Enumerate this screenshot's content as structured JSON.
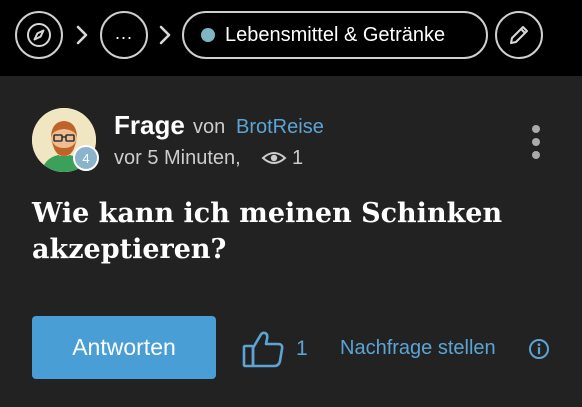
{
  "breadcrumb": {
    "more_label": "...",
    "category_label": "Lebensmittel & Getränke",
    "category_color": "#7fb6c4"
  },
  "post": {
    "type_label": "Frage",
    "by_label": "von",
    "author": "BrotReise",
    "author_level": "4",
    "time": "vor 5 Minuten,",
    "views": "1",
    "question": "Wie kann ich meinen Schinken akzeptieren?"
  },
  "actions": {
    "answer_label": "Antworten",
    "like_count": "1",
    "followup_label": "Nachfrage stellen"
  },
  "colors": {
    "accent": "#4a9ed6",
    "link": "#5ba4d4",
    "background": "#222222",
    "topbar": "#000000"
  },
  "icons": [
    "compass-icon",
    "chevron-right-icon",
    "pencil-icon",
    "eye-icon",
    "kebab-menu-icon",
    "thumbs-up-icon",
    "info-icon"
  ]
}
